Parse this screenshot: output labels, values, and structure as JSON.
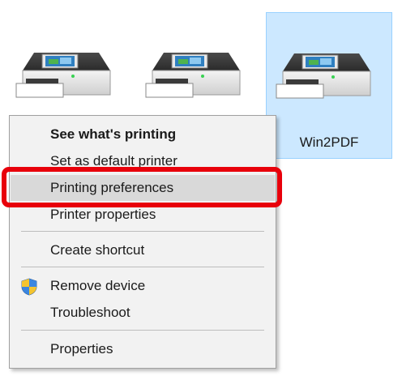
{
  "printers": [
    {
      "label": "",
      "selected": false
    },
    {
      "label": "",
      "selected": false
    },
    {
      "label": "Win2PDF",
      "selected": true
    }
  ],
  "context_menu": {
    "items": [
      {
        "label": "See what's printing",
        "bold": true,
        "icon": null
      },
      {
        "label": "Set as default printer",
        "bold": false,
        "icon": null
      },
      {
        "label": "Printing preferences",
        "bold": false,
        "icon": null,
        "highlighted": true
      },
      {
        "label": "Printer properties",
        "bold": false,
        "icon": null
      },
      {
        "label": "Create shortcut",
        "bold": false,
        "icon": null
      },
      {
        "label": "Remove device",
        "bold": false,
        "icon": "uac-shield-icon"
      },
      {
        "label": "Troubleshoot",
        "bold": false,
        "icon": null
      },
      {
        "label": "Properties",
        "bold": false,
        "icon": null
      }
    ]
  },
  "colors": {
    "selection_bg": "#cce8ff",
    "selection_border": "#99d1ff",
    "menu_bg": "#f2f2f2",
    "menu_hover": "#d9d9d9",
    "annotation_red": "#e8000b"
  }
}
